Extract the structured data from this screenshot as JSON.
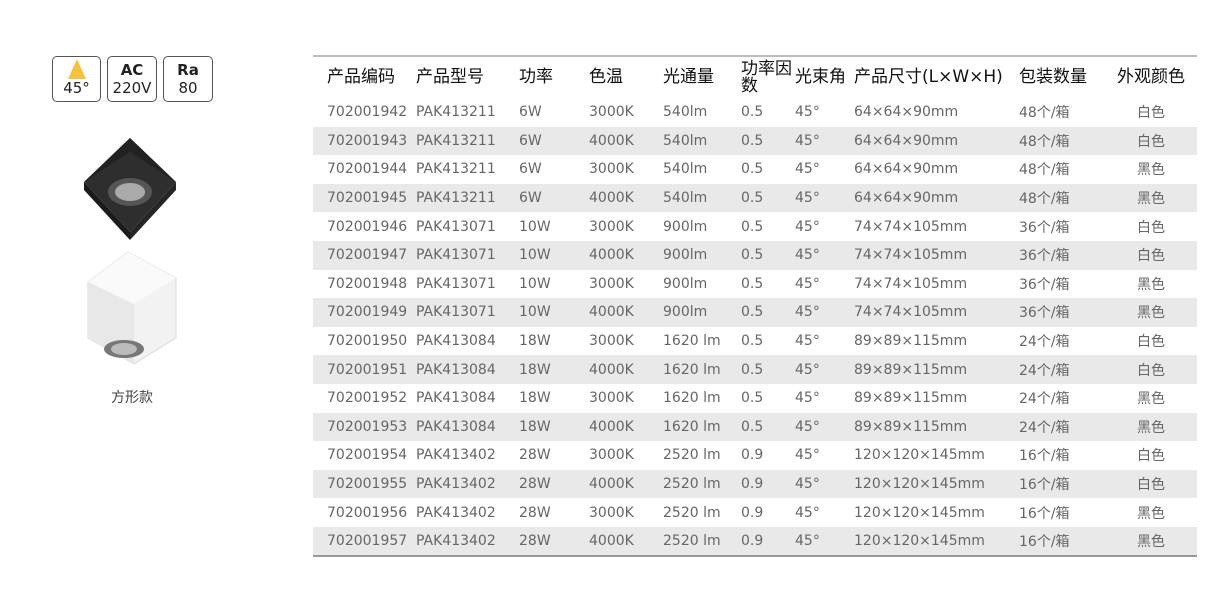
{
  "badges": {
    "angle": "45°",
    "ac_top": "AC",
    "ac_bottom": "220V",
    "ra_top": "Ra",
    "ra_bottom": "80"
  },
  "product_caption": "方形款",
  "table": {
    "headers": [
      "产品编码",
      "产品型号",
      "功率",
      "色温",
      "光通量",
      "功率因数",
      "光束角",
      "产品尺寸(L×W×H)",
      "包装数量",
      "外观颜色"
    ],
    "rows": [
      [
        "702001942",
        "PAK413211",
        "6W",
        "3000K",
        "540lm",
        "0.5",
        "45°",
        "64×64×90mm",
        "48个/箱",
        "白色"
      ],
      [
        "702001943",
        "PAK413211",
        "6W",
        "4000K",
        "540lm",
        "0.5",
        "45°",
        "64×64×90mm",
        "48个/箱",
        "白色"
      ],
      [
        "702001944",
        "PAK413211",
        "6W",
        "3000K",
        "540lm",
        "0.5",
        "45°",
        "64×64×90mm",
        "48个/箱",
        "黑色"
      ],
      [
        "702001945",
        "PAK413211",
        "6W",
        "4000K",
        "540lm",
        "0.5",
        "45°",
        "64×64×90mm",
        "48个/箱",
        "黑色"
      ],
      [
        "702001946",
        "PAK413071",
        "10W",
        "3000K",
        "900lm",
        "0.5",
        "45°",
        "74×74×105mm",
        "36个/箱",
        "白色"
      ],
      [
        "702001947",
        "PAK413071",
        "10W",
        "4000K",
        "900lm",
        "0.5",
        "45°",
        "74×74×105mm",
        "36个/箱",
        "白色"
      ],
      [
        "702001948",
        "PAK413071",
        "10W",
        "3000K",
        "900lm",
        "0.5",
        "45°",
        "74×74×105mm",
        "36个/箱",
        "黑色"
      ],
      [
        "702001949",
        "PAK413071",
        "10W",
        "4000K",
        "900lm",
        "0.5",
        "45°",
        "74×74×105mm",
        "36个/箱",
        "黑色"
      ],
      [
        "702001950",
        "PAK413084",
        "18W",
        "3000K",
        "1620 lm",
        "0.5",
        "45°",
        "89×89×115mm",
        "24个/箱",
        "白色"
      ],
      [
        "702001951",
        "PAK413084",
        "18W",
        "4000K",
        "1620 lm",
        "0.5",
        "45°",
        "89×89×115mm",
        "24个/箱",
        "白色"
      ],
      [
        "702001952",
        "PAK413084",
        "18W",
        "3000K",
        "1620 lm",
        "0.5",
        "45°",
        "89×89×115mm",
        "24个/箱",
        "黑色"
      ],
      [
        "702001953",
        "PAK413084",
        "18W",
        "4000K",
        "1620 lm",
        "0.5",
        "45°",
        "89×89×115mm",
        "24个/箱",
        "黑色"
      ],
      [
        "702001954",
        "PAK413402",
        "28W",
        "3000K",
        "2520 lm",
        "0.9",
        "45°",
        "120×120×145mm",
        "16个/箱",
        "白色"
      ],
      [
        "702001955",
        "PAK413402",
        "28W",
        "4000K",
        "2520 lm",
        "0.9",
        "45°",
        "120×120×145mm",
        "16个/箱",
        "白色"
      ],
      [
        "702001956",
        "PAK413402",
        "28W",
        "3000K",
        "2520 lm",
        "0.9",
        "45°",
        "120×120×145mm",
        "16个/箱",
        "黑色"
      ],
      [
        "702001957",
        "PAK413402",
        "28W",
        "4000K",
        "2520 lm",
        "0.9",
        "45°",
        "120×120×145mm",
        "16个/箱",
        "黑色"
      ]
    ]
  }
}
